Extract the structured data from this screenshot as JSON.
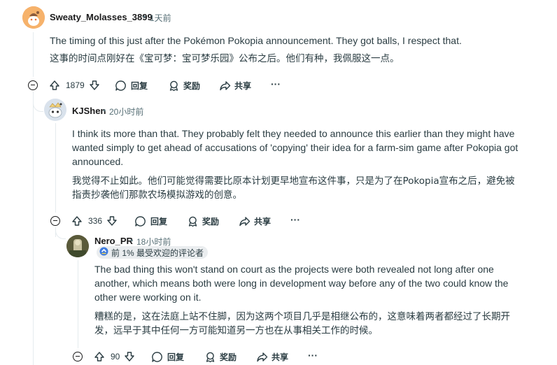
{
  "comments": [
    {
      "username": "Sweaty_Molasses_3899",
      "time": "1天前",
      "text_en": "The timing of this just after the Pokémon Pokopia announcement. They got balls, I respect that.",
      "text_zh": "这事的时间点刚好在《宝可梦：宝可梦乐园》公布之后。他们有种，我佩服这一点。",
      "votes": "1879",
      "reply_label": "回复",
      "award_label": "奖励",
      "share_label": "共享",
      "more_label": "···"
    },
    {
      "username": "KJShen",
      "time": "20小时前",
      "text_en_lines": [
        "I think its more than that. They probably felt they needed to announce this earlier than they might have",
        "wanted simply to get ahead of accusations of 'copying' their idea for a farm-sim game after Pokopia got",
        "announced."
      ],
      "text_zh_lines": [
        "我觉得不止如此。他们可能觉得需要比原本计划更早地宣布这件事，只是为了在Pokopia宣布之后，避免被",
        "指责抄袭他们那款农场模拟游戏的创意。"
      ],
      "votes": "336",
      "reply_label": "回复",
      "award_label": "奖励",
      "share_label": "共享",
      "more_label": "···"
    },
    {
      "username": "Nero_PR",
      "time": "18小时前",
      "badge": "前 1% 最受欢迎的评论者",
      "text_en_lines": [
        "The bad thing this won't stand on court as the projects were both revealed not long after one",
        "another, which means both were long in development way before any of the two could know the",
        "other were working on it."
      ],
      "text_zh_lines": [
        "糟糕的是，这在法庭上站不住脚，因为这两个项目几乎是相继公布的，这意味着两者都经过了长期开",
        "发，远早于其中任何一方可能知道另一方也在从事相关工作的时候。"
      ],
      "votes": "90",
      "reply_label": "回复",
      "award_label": "奖励",
      "share_label": "共享",
      "more_label": "···"
    }
  ],
  "separator": "•",
  "colors": {
    "text": "#2a3c42",
    "meta": "#576f76",
    "line": "#e5ebee",
    "badge_bg": "#eaedef"
  }
}
